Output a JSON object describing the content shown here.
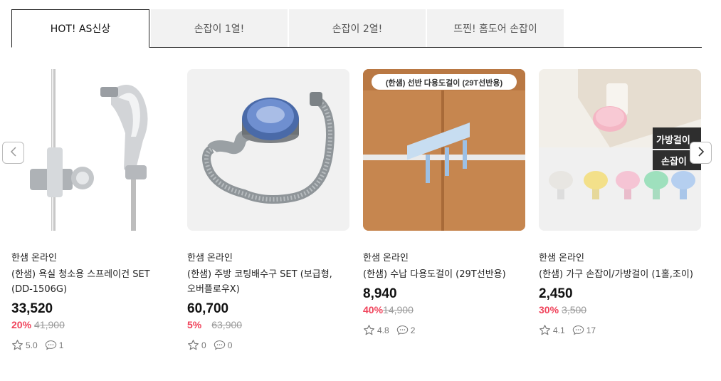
{
  "tabs": [
    {
      "label": "HOT! AS신상",
      "active": true
    },
    {
      "label": "손잡이 1열!",
      "active": false
    },
    {
      "label": "손잡이 2열!",
      "active": false
    },
    {
      "label": "뜨찐! 홈도어 손잡이",
      "active": false
    }
  ],
  "products": [
    {
      "image_icon": "spray-gun-image",
      "seller": "한샘 온라인",
      "name": "(한샘) 욕실 청소용 스프레이건 SET (DD-1506G)",
      "price": "33,520",
      "discount": "20%",
      "original_price": "41,900",
      "rating": "5.0",
      "reviews": "1"
    },
    {
      "image_icon": "drain-pipe-image",
      "seller": "한샘 온라인",
      "name": "(한샘) 주방 코팅배수구 SET (보급형,오버플로우X)",
      "price": "60,700",
      "discount": "5%",
      "original_price": "63,900",
      "rating": "0",
      "reviews": "0"
    },
    {
      "image_icon": "shelf-hook-image",
      "image_caption": "(한샘) 선반 다용도걸이 (29T선반용)",
      "seller": "한샘 온라인",
      "name": "(한샘) 수납 다용도걸이 (29T선반용)",
      "price": "8,940",
      "discount": "40%",
      "original_price": "14,900",
      "rating": "4.8",
      "reviews": "2"
    },
    {
      "image_icon": "knob-hook-image",
      "image_caption_1": "가방걸이",
      "image_caption_2": "손잡이",
      "seller": "한샘 온라인",
      "name": "(한샘) 가구 손잡이/가방걸이 (1홀,조이)",
      "price": "2,450",
      "discount": "30%",
      "original_price": "3,500",
      "rating": "4.1",
      "reviews": "17"
    }
  ],
  "nav": {
    "prev_icon": "chevron-left-icon",
    "next_icon": "chevron-right-icon"
  },
  "colors": {
    "discount": "#f0435b",
    "price": "#111111",
    "tab_active_border": "#222222"
  }
}
